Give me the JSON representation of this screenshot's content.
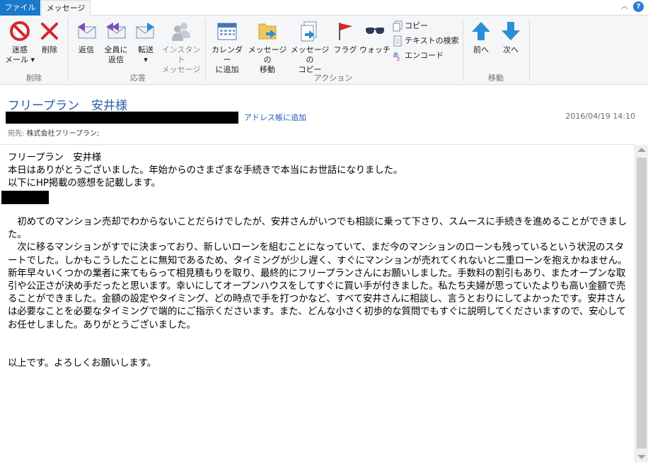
{
  "tabs": {
    "file": "ファイル",
    "message": "メッセージ"
  },
  "ribbon": {
    "delete_group": {
      "label": "削除",
      "junk_line1": "迷惑",
      "junk_line2": "メール ▾",
      "delete": "削除"
    },
    "respond_group": {
      "label": "応答",
      "reply": "返信",
      "reply_all_line1": "全員に",
      "reply_all_line2": "返信",
      "forward_line1": "転送",
      "forward_line2": "▾",
      "instant_line1": "インスタント",
      "instant_line2": "メッセージ"
    },
    "action_group": {
      "label": "アクション",
      "calendar_line1": "カレンダー",
      "calendar_line2": "に追加",
      "move_line1": "メッセージの",
      "move_line2": "移動",
      "copy_msg_line1": "メッセージの",
      "copy_msg_line2": "コピー",
      "flag": "フラグ",
      "watch": "ウォッチ",
      "copy": "コピー",
      "find_text": "テキストの検索",
      "encode": "エンコード"
    },
    "move_group": {
      "label": "移動",
      "prev": "前へ",
      "next": "次へ"
    }
  },
  "header": {
    "subject": "フリープラン　安井様",
    "add_to_contacts": "アドレス帳に追加",
    "date": "2016/04/19 14:10",
    "to_label": "宛先: ",
    "to_value": "株式会社フリープラン;"
  },
  "body": {
    "text": "フリープラン　安井様\n本日はありがとうございました。年始からのさまざまな手続きで本当にお世話になりました。\n以下にHP掲載の感想を記載します。\n\n\n　初めてのマンション売却でわからないことだらけでしたが、安井さんがいつでも相談に乗って下さり、スムースに手続きを進めることができました。\n　次に移るマンションがすでに決まっており、新しいローンを組むことになっていて、まだ今のマンションのローンも残っているという状況のスタートでした。しかもこうしたことに無知であるため、タイミングが少し遅く、すぐにマンションが売れてくれないと二重ローンを抱えかねません。新年早々いくつかの業者に来てもらって相見積もりを取り、最終的にフリープランさんにお願いしました。手数料の割引もあり、またオープンな取引や公正さが決め手だったと思います。幸いにしてオープンハウスをしてすぐに買い手が付きました。私たち夫婦が思っていたよりも高い金額で売ることができました。金額の設定やタイミング、どの時点で手を打つかなど、すべて安井さんに相談し、言うとおりにしてよかったです。安井さんは必要なことを必要なタイミングで端的にご指示くださいます。また、どんな小さく初歩的な質問でもすぐに説明してくださいますので、安心してお任せしました。ありがとうございました。\n\n\n以上です。よろしくお願いします。"
  },
  "colors": {
    "file_tab": "#1979ca",
    "subject": "#2a5aa8",
    "link": "#1f5fb0",
    "ribbon_bg": "#f5f6f7"
  }
}
